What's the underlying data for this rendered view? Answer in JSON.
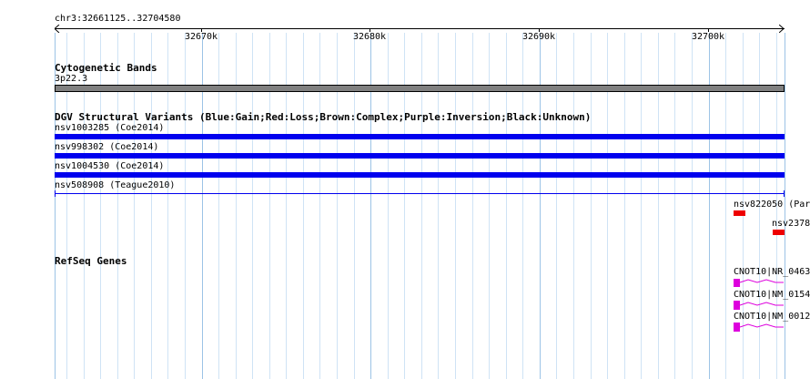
{
  "ruler": {
    "location": "chr3:32661125..32704580",
    "ticks": [
      "32670k",
      "32680k",
      "32690k",
      "32700k"
    ]
  },
  "cytoband": {
    "title": "Cytogenetic Bands",
    "band_label": "3p22.3"
  },
  "dgv": {
    "title": "DGV Structural Variants (Blue:Gain;Red:Loss;Brown:Complex;Purple:Inversion;Black:Unknown)",
    "variants": [
      {
        "label": "nsv1003285 (Coe2014)",
        "type": "gain"
      },
      {
        "label": "nsv998302 (Coe2014)",
        "type": "gain"
      },
      {
        "label": "nsv1004530 (Coe2014)",
        "type": "gain"
      },
      {
        "label": "nsv508908 (Teague2010)",
        "type": "gain"
      },
      {
        "label": "nsv822050 (Par",
        "type": "loss"
      },
      {
        "label": "nsv2378",
        "type": "loss"
      }
    ],
    "colors": {
      "gain": "#0000ee",
      "loss": "#ee0000"
    }
  },
  "refseq": {
    "title": "RefSeq Genes",
    "genes": [
      {
        "label": "CNOT10|NR_0463"
      },
      {
        "label": "CNOT10|NM_0154"
      },
      {
        "label": "CNOT10|NM_0012"
      }
    ],
    "color": "#dd00dd"
  }
}
